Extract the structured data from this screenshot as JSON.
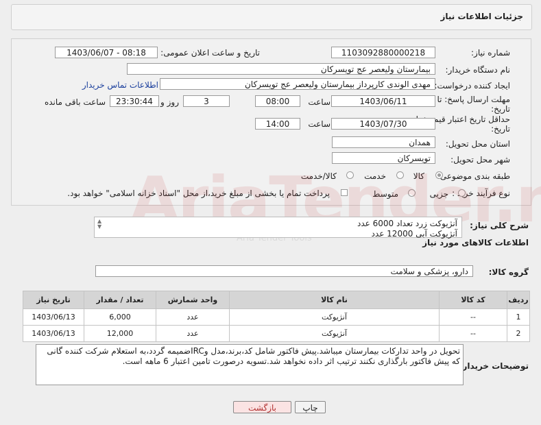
{
  "header": {
    "title": "جزئیات اطلاعات نیاز"
  },
  "form": {
    "need_number_label": "شماره نیاز:",
    "need_number": "1103092880000218",
    "announce_label": "تاریخ و ساعت اعلان عمومی:",
    "announce_value": "1403/06/07 - 08:18",
    "buyer_org_label": "نام دستگاه خریدار:",
    "buyer_org": "بیمارستان ولیعصر  عج  تویسرکان",
    "requester_label": "ایجاد کننده درخواست:",
    "requester": "مهدی الوندی کارپرداز بیمارستان ولیعصر  عج  تویسرکان",
    "contact_link": "اطلاعات تماس خریدار",
    "deadline_label_1": "مهلت ارسال پاسخ: تا",
    "deadline_label_2": "تاریخ:",
    "deadline_date": "1403/06/11",
    "time_label": "ساعت",
    "deadline_time": "08:00",
    "days_value": "3",
    "days_label": "روز و",
    "remaining_time": "23:30:44",
    "remaining_label": "ساعت باقی مانده",
    "validity_label_1": "حداقل تاریخ اعتبار قیمت: تا",
    "validity_label_2": "تاریخ:",
    "validity_date": "1403/07/30",
    "validity_time": "14:00",
    "province_label": "استان محل تحویل:",
    "province": "همدان",
    "city_label": "شهر محل تحویل:",
    "city": "تویسرکان",
    "category_label": "طبقه بندی موضوعی:",
    "category_options": [
      "کالا",
      "خدمت",
      "کالا/خدمت"
    ],
    "process_label": "نوع فرآیند خرید :",
    "process_options": [
      "جزیی",
      "متوسط"
    ],
    "payment_note": "پرداخت تمام یا بخشی از مبلغ خرید،از محل \"اسناد خزانه اسلامی\" خواهد بود."
  },
  "summary": {
    "label": "شرح کلی نیاز:",
    "lines": [
      "آنژیوکت زرد تعداد 6000 عدد",
      "آنژیوکت آبی 12000 عدد"
    ]
  },
  "goods": {
    "section_title": "اطلاعات کالاهای مورد نیاز",
    "group_label": "گروه کالا:",
    "group_value": "دارو، پزشکی و سلامت",
    "columns": [
      "ردیف",
      "کد کالا",
      "نام کالا",
      "واحد شمارش",
      "تعداد / مقدار",
      "تاریخ نیاز"
    ],
    "rows": [
      [
        "1",
        "--",
        "آنژیوکت",
        "عدد",
        "6,000",
        "1403/06/13"
      ],
      [
        "2",
        "--",
        "آنژیوکت",
        "عدد",
        "12,000",
        "1403/06/13"
      ]
    ]
  },
  "buyer_notes": {
    "label": "توضیحات خریدار:",
    "text": "تحویل در واحد تدارکات بیمارستان میباشد.پیش فاکتور شامل کد،برند،مدل وIRCضمیمه گردد،به استعلام شرکت کننده گانی که پیش فاکتور بارگذاری نکنند ترتیب اثر داده نخواهد شد.تسویه درصورت تامین اعتبار 6 ماهه است."
  },
  "buttons": {
    "print": "چاپ",
    "back": "بازگشت"
  },
  "watermark": {
    "brand": "AriaTender.neT",
    "tagline": "Aria Tender Tools"
  },
  "colors": {
    "link": "#1a3e9c",
    "back_button_bg": "#fbe3e3",
    "back_button_text": "#b03030",
    "watermark": "#c83c3c"
  }
}
